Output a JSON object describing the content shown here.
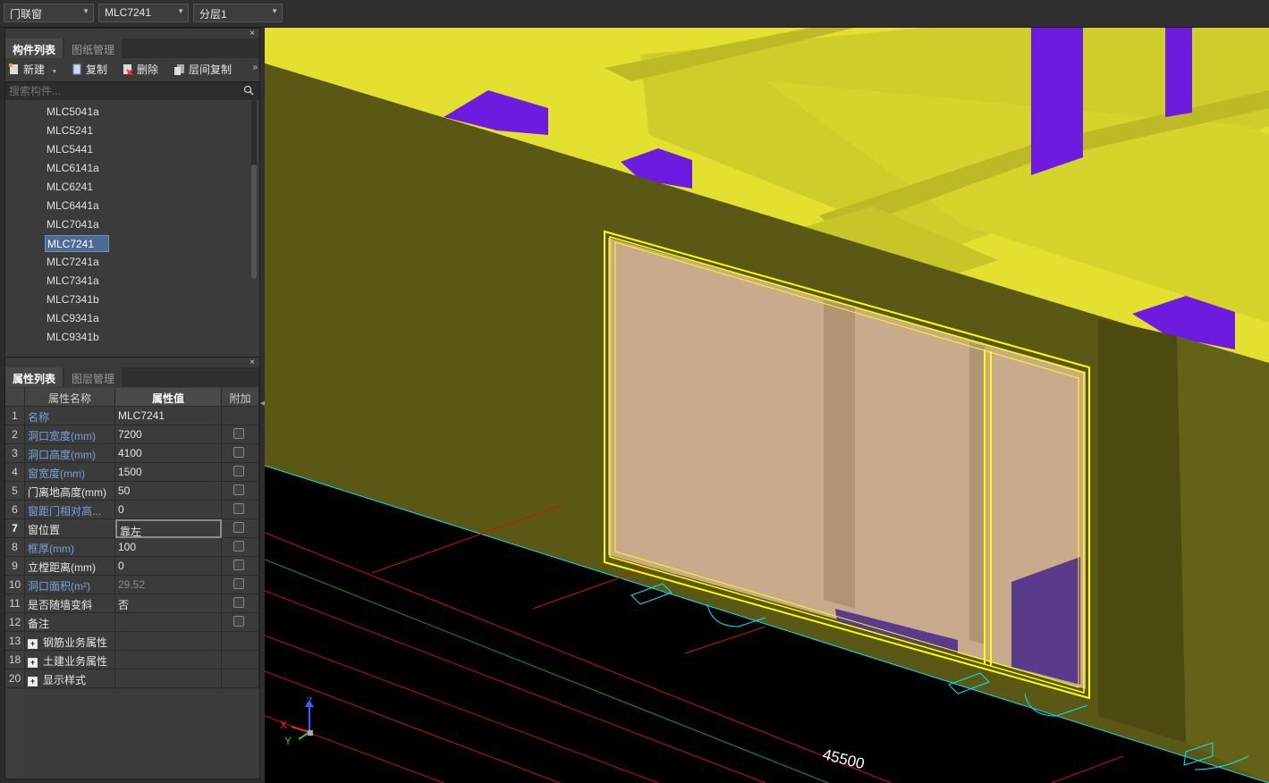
{
  "toolbar": {
    "type_select": "门联窗",
    "component_select": "MLC7241",
    "floor_select": "分层1"
  },
  "component_panel": {
    "close": "×",
    "tabs": [
      "构件列表",
      "图纸管理"
    ],
    "buttons": {
      "new": "新建",
      "copy": "复制",
      "delete": "删除",
      "floor_copy": "层间复制"
    },
    "search_placeholder": "搜索构件...",
    "items": [
      "MLC5041a",
      "MLC5241",
      "MLC5441",
      "MLC6141a",
      "MLC6241",
      "MLC6441a",
      "MLC7041a",
      "MLC7241",
      "MLC7241a",
      "MLC7341a",
      "MLC7341b",
      "MLC9341a",
      "MLC9341b"
    ],
    "selected": "MLC7241"
  },
  "property_panel": {
    "close": "×",
    "tabs": [
      "属性列表",
      "图层管理"
    ],
    "headers": {
      "name": "属性名称",
      "value": "属性值",
      "extra": "附加"
    },
    "rows": [
      {
        "num": "1",
        "name": "名称",
        "value": "MLC7241",
        "color": "blue",
        "checkbox": false
      },
      {
        "num": "2",
        "name": "洞口宽度(mm)",
        "value": "7200",
        "color": "blue",
        "checkbox": true
      },
      {
        "num": "3",
        "name": "洞口高度(mm)",
        "value": "4100",
        "color": "blue",
        "checkbox": true
      },
      {
        "num": "4",
        "name": "窗宽度(mm)",
        "value": "1500",
        "color": "blue",
        "checkbox": true
      },
      {
        "num": "5",
        "name": "门离地高度(mm)",
        "value": "50",
        "color": "white",
        "checkbox": true
      },
      {
        "num": "6",
        "name": "窗距门相对高...",
        "value": "0",
        "color": "blue",
        "checkbox": true
      },
      {
        "num": "7",
        "name": "窗位置",
        "value": "靠左",
        "color": "white",
        "checkbox": true
      },
      {
        "num": "8",
        "name": "框厚(mm)",
        "value": "100",
        "color": "blue",
        "checkbox": true
      },
      {
        "num": "9",
        "name": "立樘距离(mm)",
        "value": "0",
        "color": "white",
        "checkbox": true
      },
      {
        "num": "10",
        "name": "洞口面积(m²)",
        "value": "29.52",
        "color": "blue",
        "value_grey": true,
        "checkbox": true
      },
      {
        "num": "11",
        "name": "是否随墙变斜",
        "value": "否",
        "color": "white",
        "checkbox": true
      },
      {
        "num": "12",
        "name": "备注",
        "value": "",
        "color": "white",
        "checkbox": true
      },
      {
        "num": "13",
        "name": "钢筋业务属性",
        "value": "",
        "color": "white",
        "group": true
      },
      {
        "num": "18",
        "name": "土建业务属性",
        "value": "",
        "color": "white",
        "group": true
      },
      {
        "num": "20",
        "name": "显示样式",
        "value": "",
        "color": "white",
        "group": true
      }
    ],
    "active_row": "7"
  },
  "viewport": {
    "dimension_label": "45500",
    "axes": {
      "x": "X",
      "y": "Y",
      "z": "Z"
    },
    "colors": {
      "slab": "#e3e030",
      "wall": "#5a5814",
      "beam": "#6e1be0",
      "glass": "#c8aa8c",
      "highlight": "#ffff00"
    }
  }
}
